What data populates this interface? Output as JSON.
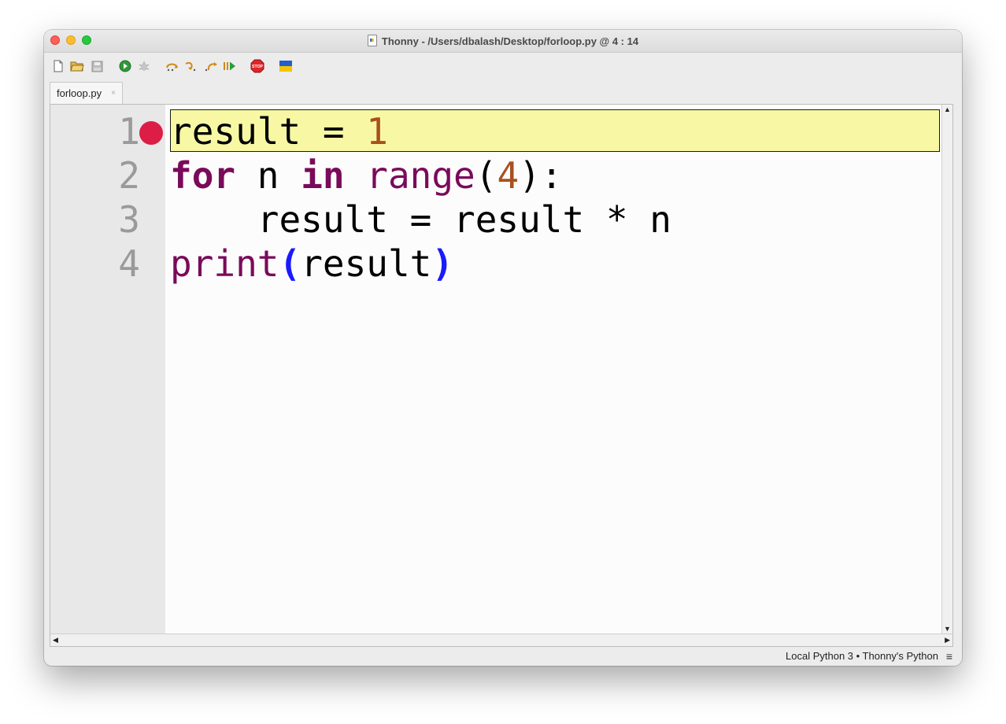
{
  "window": {
    "title": "Thonny  -  /Users/dbalash/Desktop/forloop.py  @  4 : 14"
  },
  "toolbar": {
    "buttons": [
      {
        "name": "new-file-icon"
      },
      {
        "name": "open-file-icon"
      },
      {
        "name": "save-file-icon"
      },
      {
        "name": "run-icon"
      },
      {
        "name": "debug-icon"
      },
      {
        "name": "step-over-icon"
      },
      {
        "name": "step-into-icon"
      },
      {
        "name": "step-out-icon"
      },
      {
        "name": "resume-icon"
      },
      {
        "name": "stop-icon",
        "label": "STOP"
      },
      {
        "name": "ukraine-flag-icon"
      }
    ]
  },
  "tabs": [
    {
      "label": "forloop.py",
      "close": "×"
    }
  ],
  "editor": {
    "line_numbers": [
      "1",
      "2",
      "3",
      "4"
    ],
    "breakpoint_line": "1",
    "highlighted_line": "1",
    "lines": [
      [
        {
          "t": "result = ",
          "c": "plain"
        },
        {
          "t": "1",
          "c": "num"
        }
      ],
      [
        {
          "t": "for",
          "c": "kw"
        },
        {
          "t": " n ",
          "c": "plain"
        },
        {
          "t": "in",
          "c": "kw"
        },
        {
          "t": " ",
          "c": "plain"
        },
        {
          "t": "range",
          "c": "bi"
        },
        {
          "t": "(",
          "c": "plain"
        },
        {
          "t": "4",
          "c": "num"
        },
        {
          "t": "):",
          "c": "plain"
        }
      ],
      [
        {
          "t": "    result = result * n",
          "c": "plain"
        }
      ],
      [
        {
          "t": "print",
          "c": "bi"
        },
        {
          "t": "(",
          "c": "paren"
        },
        {
          "t": "result",
          "c": "plain"
        },
        {
          "t": ")",
          "c": "paren"
        }
      ]
    ]
  },
  "status": {
    "interpreter": "Local Python 3  •  Thonny's Python",
    "menu_glyph": "≡"
  },
  "colors": {
    "highlight": "#f8f8a4",
    "breakpoint": "#dc1e46",
    "keyword": "#7a0a5a",
    "number": "#a8501e",
    "paren": "#1a1aff"
  }
}
